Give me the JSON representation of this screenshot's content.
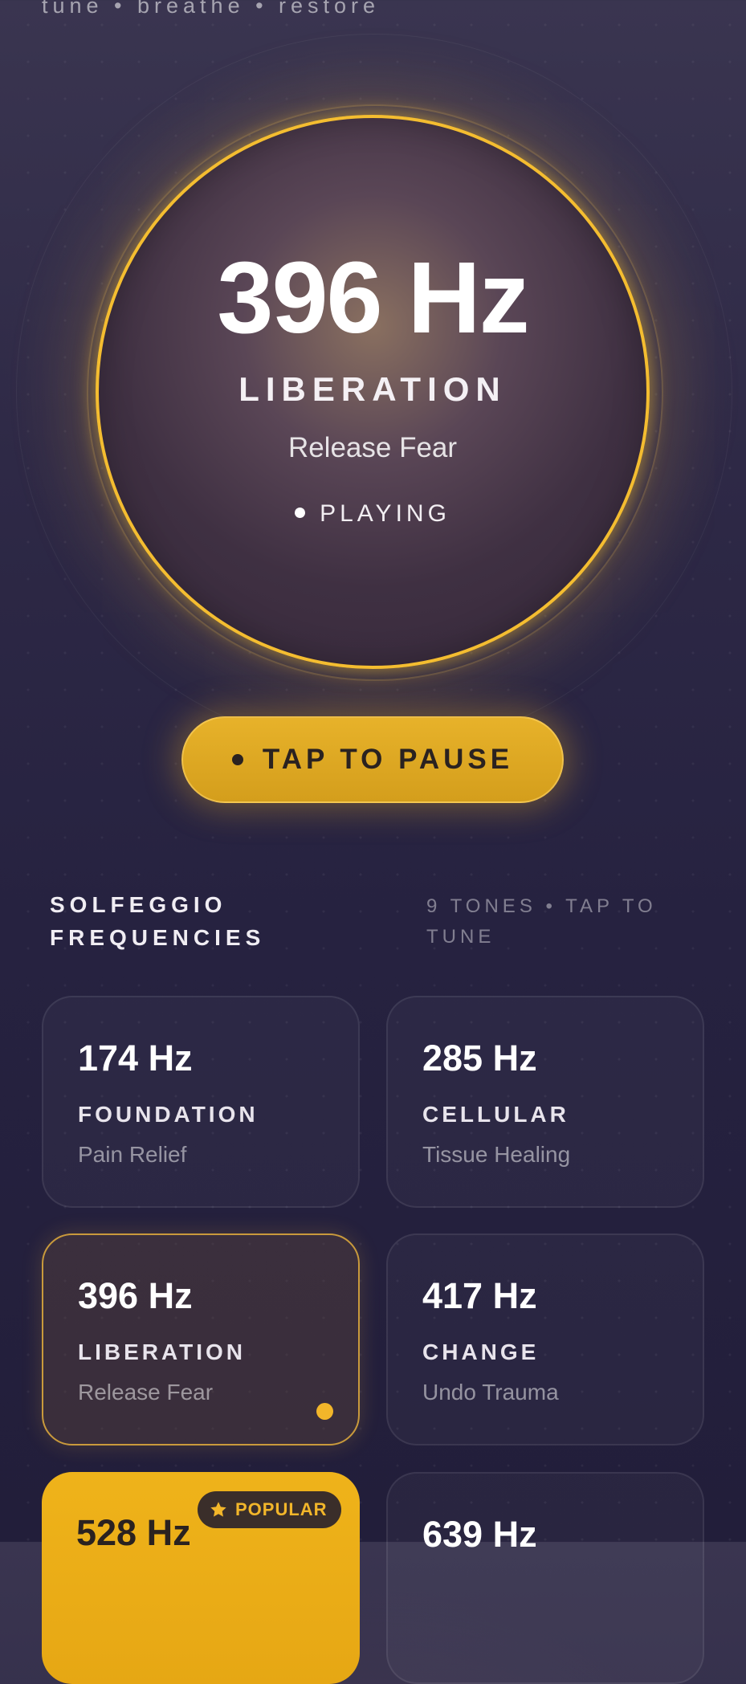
{
  "tagline": "tune • breathe • restore",
  "player": {
    "frequency": "396 Hz",
    "name": "LIBERATION",
    "benefit": "Release Fear",
    "status": "PLAYING"
  },
  "pause_button": {
    "label": "TAP TO PAUSE"
  },
  "section": {
    "title": "SOLFEGGIO FREQUENCIES",
    "hint": "9 TONES • TAP TO TUNE"
  },
  "tones": [
    {
      "frequency": "174 Hz",
      "name": "FOUNDATION",
      "benefit": "Pain Relief"
    },
    {
      "frequency": "285 Hz",
      "name": "CELLULAR",
      "benefit": "Tissue Healing"
    },
    {
      "frequency": "396 Hz",
      "name": "LIBERATION",
      "benefit": "Release Fear",
      "selected": true
    },
    {
      "frequency": "417 Hz",
      "name": "CHANGE",
      "benefit": "Undo Trauma"
    },
    {
      "frequency": "528 Hz",
      "badge": "POPULAR"
    },
    {
      "frequency": "639 Hz"
    }
  ],
  "colors": {
    "accent": "#f4bd30",
    "background": "#2e2946",
    "popular_card": "#efb31a"
  }
}
